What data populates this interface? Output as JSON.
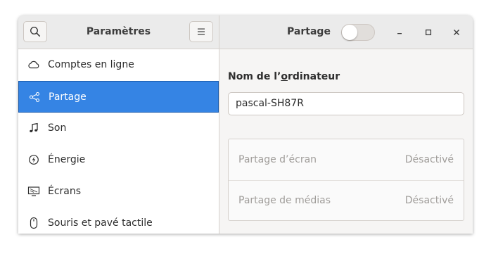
{
  "window": {
    "left_title": "Paramètres",
    "right_title": "Partage",
    "sharing_toggle_on": false
  },
  "icons": {
    "search": "search-icon",
    "menu": "hamburger-menu-icon",
    "minimize": "minimize-icon",
    "maximize": "maximize-icon",
    "close": "close-icon"
  },
  "sidebar": {
    "items": [
      {
        "label": "Comptes en ligne",
        "icon": "cloud-icon",
        "selected": false
      },
      {
        "label": "Partage",
        "icon": "share-icon",
        "selected": true
      },
      {
        "label": "Son",
        "icon": "music-note-icon",
        "selected": false
      },
      {
        "label": "Énergie",
        "icon": "power-icon",
        "selected": false
      },
      {
        "label": "Écrans",
        "icon": "display-icon",
        "selected": false
      },
      {
        "label": "Souris et pavé tactile",
        "icon": "mouse-icon",
        "selected": false
      }
    ]
  },
  "main": {
    "computer_name_label_pre": "Nom de l’",
    "computer_name_label_u": "o",
    "computer_name_label_post": "rdinateur",
    "computer_name_value": "pascal-SH87R",
    "rows": [
      {
        "label": "Partage d’écran",
        "status": "Désactivé"
      },
      {
        "label": "Partage de médias",
        "status": "Désactivé"
      }
    ]
  },
  "colors": {
    "accent": "#3584e4",
    "headerbar": "#ebebeb",
    "sidebar_bg": "#ffffff",
    "content_bg": "#f6f5f4",
    "disabled_text": "#a09d9a"
  }
}
